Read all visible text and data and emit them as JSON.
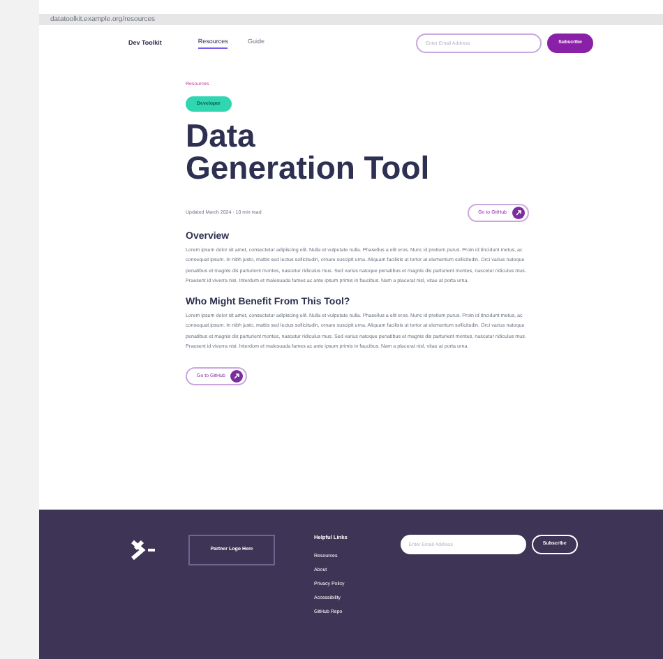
{
  "browser_bar": {
    "address": "datatoolkit.example.org/resources"
  },
  "header": {
    "brand": "Dev Toolkit",
    "nav": [
      {
        "label": "Resources",
        "selected": true
      },
      {
        "label": "Guide",
        "selected": false
      }
    ],
    "email_placeholder": "Enter Email Address",
    "subscribe": "Subscribe"
  },
  "breadcrumb": "Resources",
  "tag": "Developer",
  "title_lines": [
    "Data",
    "Generation Tool"
  ],
  "meta": "Updated March 2024 · 10 min read",
  "github_button": "Go to GitHub",
  "sections": [
    {
      "heading": "Overview",
      "body": "Lorem ipsum dolor sit amet, consectetur adipiscing elit. Nulla et vulputate nulla. Phasellus a elit eros. Nunc id pretium purus. Proin id tincidunt metus, ac consequat ipsum. In nibh justo, mattis sed lectus sollicitudin, ornare suscipit urna. Aliquam facilisis ut tortor at elementum sollicitudin. Orci varius natoque penatibus et magnis dis parturient montes, nascetur ridiculus mus. Sed varius natoque penatibus et magnis dis parturient montes, nascetur ridiculus mus. Praesent id viverra nisi. Interdum et malesuada fames ac ante ipsum primis in faucibus. Nam a placerat nisl, vitae at porta urna."
    },
    {
      "heading": "Who Might Benefit From This Tool?",
      "body": "Lorem ipsum dolor sit amet, consectetur adipiscing elit. Nulla et vulputate nulla. Phasellus a elit eros. Nunc id pretium purus. Proin id tincidunt metus, ac consequat ipsum. In nibh justo, mattis sed lectus sollicitudin, ornare suscipit urna. Aliquam facilisis ut tortor at elementum sollicitudin. Orci varius natoque penatibus et magnis dis parturient montes, nascetur ridiculus mus. Sed varius natoque penatibus et magnis dis parturient montes, nascetur ridiculus mus. Praesent id viverra nisi. Interdum et malesuada fames ac ante ipsum primis in faucibus. Nam a placerat nisl, vitae at porta urna."
    }
  ],
  "bottom_button": "Go to GitHub",
  "footer": {
    "partner_logo": "Partner Logo Here",
    "links_heading": "Helpful Links",
    "links": [
      "Resources",
      "About",
      "Privacy Policy",
      "Accessibility",
      "GitHub Repo"
    ],
    "email_placeholder": "Enter Email Address",
    "subscribe": "Subscribe"
  }
}
